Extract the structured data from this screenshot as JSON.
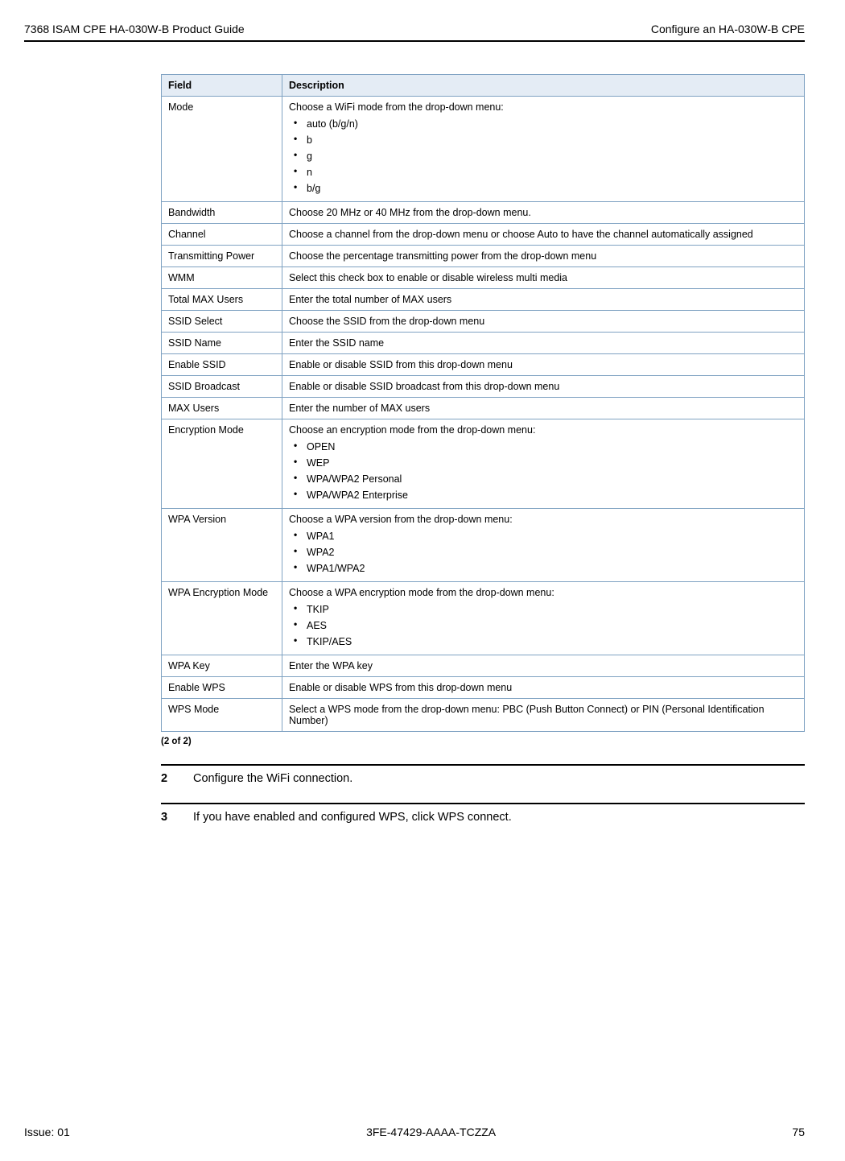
{
  "header": {
    "left": "7368 ISAM CPE HA-030W-B Product Guide",
    "right": "Configure an HA-030W-B CPE"
  },
  "table": {
    "head": {
      "field": "Field",
      "description": "Description"
    },
    "rows": [
      {
        "field": "Mode",
        "desc_intro": "Choose a WiFi mode from the drop-down menu:",
        "opts": [
          "auto (b/g/n)",
          "b",
          "g",
          "n",
          "b/g"
        ]
      },
      {
        "field": "Bandwidth",
        "desc": "Choose 20 MHz or 40 MHz from the drop-down menu."
      },
      {
        "field": "Channel",
        "desc": "Choose a channel from the drop-down menu or choose Auto to have the channel automatically assigned"
      },
      {
        "field": "Transmitting Power",
        "desc": "Choose the percentage transmitting power from the drop-down menu"
      },
      {
        "field": "WMM",
        "desc": "Select this check box to enable or disable wireless multi media"
      },
      {
        "field": "Total MAX Users",
        "desc": "Enter the total number of MAX users"
      },
      {
        "field": "SSID Select",
        "desc": "Choose the SSID from the drop-down menu"
      },
      {
        "field": "SSID Name",
        "desc": "Enter the SSID name"
      },
      {
        "field": "Enable SSID",
        "desc": "Enable or disable SSID from this drop-down menu"
      },
      {
        "field": "SSID Broadcast",
        "desc": "Enable or disable SSID broadcast from this drop-down menu"
      },
      {
        "field": "MAX Users",
        "desc": "Enter the number of MAX users"
      },
      {
        "field": "Encryption Mode",
        "desc_intro": "Choose an encryption mode from the drop-down menu:",
        "opts": [
          "OPEN",
          "WEP",
          "WPA/WPA2 Personal",
          "WPA/WPA2 Enterprise"
        ]
      },
      {
        "field": "WPA Version",
        "desc_intro": "Choose a WPA version from the drop-down menu:",
        "opts": [
          "WPA1",
          "WPA2",
          "WPA1/WPA2"
        ]
      },
      {
        "field": "WPA Encryption Mode",
        "desc_intro": "Choose a WPA encryption mode from the drop-down menu:",
        "opts": [
          "TKIP",
          "AES",
          "TKIP/AES"
        ]
      },
      {
        "field": "WPA Key",
        "desc": "Enter the WPA key"
      },
      {
        "field": "Enable WPS",
        "desc": "Enable or disable WPS from this drop-down menu"
      },
      {
        "field": "WPS Mode",
        "desc": "Select a WPS mode from the drop-down menu: PBC (Push Button Connect) or PIN (Personal Identification Number)"
      }
    ]
  },
  "pager": "(2 of 2)",
  "steps": {
    "s2": {
      "num": "2",
      "text": "Configure the WiFi connection."
    },
    "s3": {
      "num": "3",
      "text": "If you have enabled and configured WPS, click WPS connect."
    }
  },
  "footer": {
    "left": "Issue: 01",
    "center": "3FE-47429-AAAA-TCZZA",
    "right": "75"
  }
}
